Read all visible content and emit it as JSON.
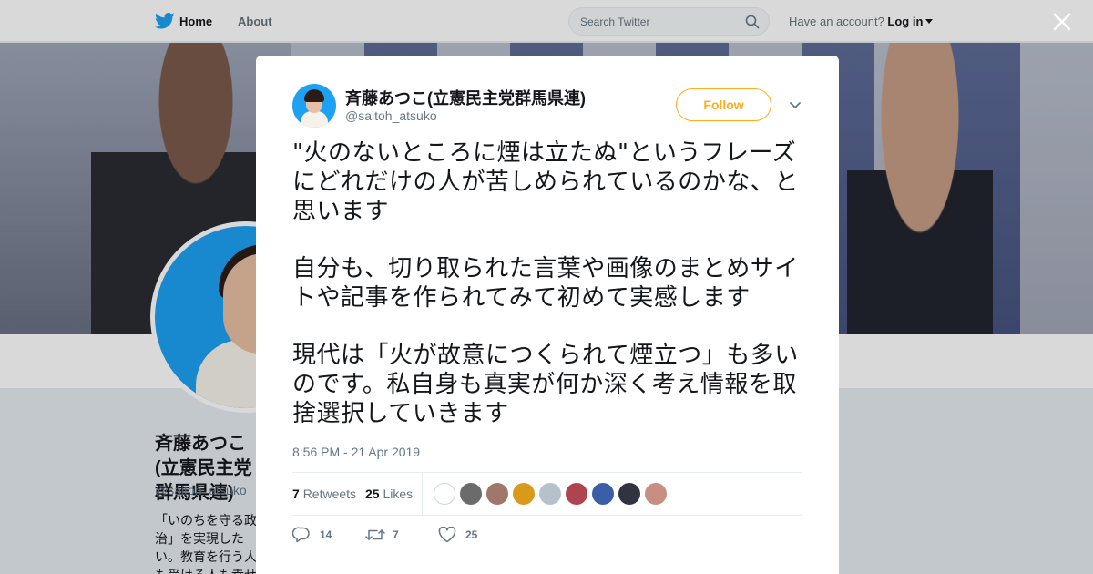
{
  "nav": {
    "home_label": "Home",
    "about_label": "About",
    "search_placeholder": "Search Twitter",
    "account_prompt": "Have an account?",
    "login_label": "Log in"
  },
  "profile": {
    "name": "斉藤あつこ(立憲民主党群馬県連)",
    "handle": "@saitoh_atsuko",
    "bio": "「いのちを守る政治」を実現したい。教育を行う人も受ける人も幸せを感じられる社会実現を目指す。学修士。大学教員"
  },
  "tweet": {
    "author_name": "斉藤あつこ(立憲民主党群馬県連)",
    "author_handle": "@saitoh_atsuko",
    "follow_label": "Follow",
    "paragraphs": [
      "\"火のないところに煙は立たぬ\"というフレーズにどれだけの人が苦しめられているのかな、と思います",
      "自分も、切り取られた言葉や画像のまとめサイトや記事を作られてみて初めて実感します",
      "現代は「火が故意につくられて煙立つ」も多いのです。私自身も真実が何か深く考え情報を取捨選択していきます"
    ],
    "timestamp": "8:56 PM - 21 Apr 2019",
    "retweets_count": "7",
    "retweets_label": "Retweets",
    "likes_count": "25",
    "likes_label": "Likes",
    "actions": {
      "replies": "14",
      "retweets": "7",
      "likes": "25"
    }
  },
  "colors": {
    "brand_blue": "#1da1f2",
    "follow_orange": "#ffad1f",
    "text_primary": "#14171a",
    "text_secondary": "#657786"
  },
  "icons": [
    "twitter-bird-icon",
    "search-icon",
    "close-icon",
    "chevron-down-icon",
    "reply-icon",
    "retweet-icon",
    "heart-icon"
  ]
}
